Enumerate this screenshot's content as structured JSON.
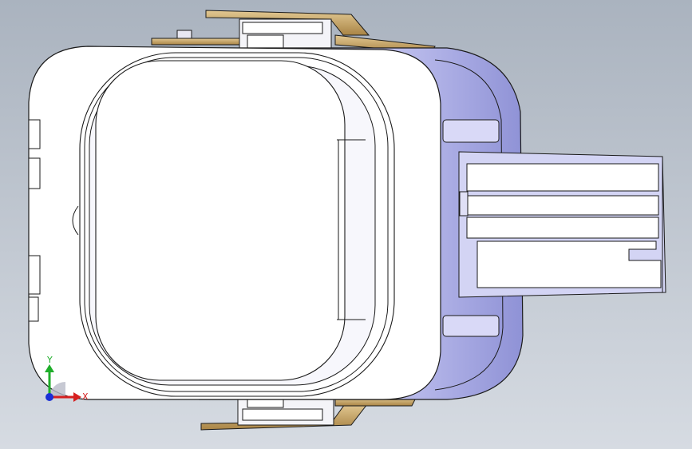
{
  "viewport": {
    "background_top": "#aab3bf",
    "background_bottom": "#d6dbe2"
  },
  "triad": {
    "x_label": "X",
    "y_label": "Y",
    "x_color": "#d62020",
    "y_color": "#1fae2a",
    "z_color": "#1a2fd6"
  },
  "colors": {
    "body_white": "#ffffff",
    "body_lavender": "#c7c8f2",
    "body_lavender_dark": "#9a9ce0",
    "terminal_gold": "#c9a86a",
    "edge": "#1a1a1a"
  }
}
